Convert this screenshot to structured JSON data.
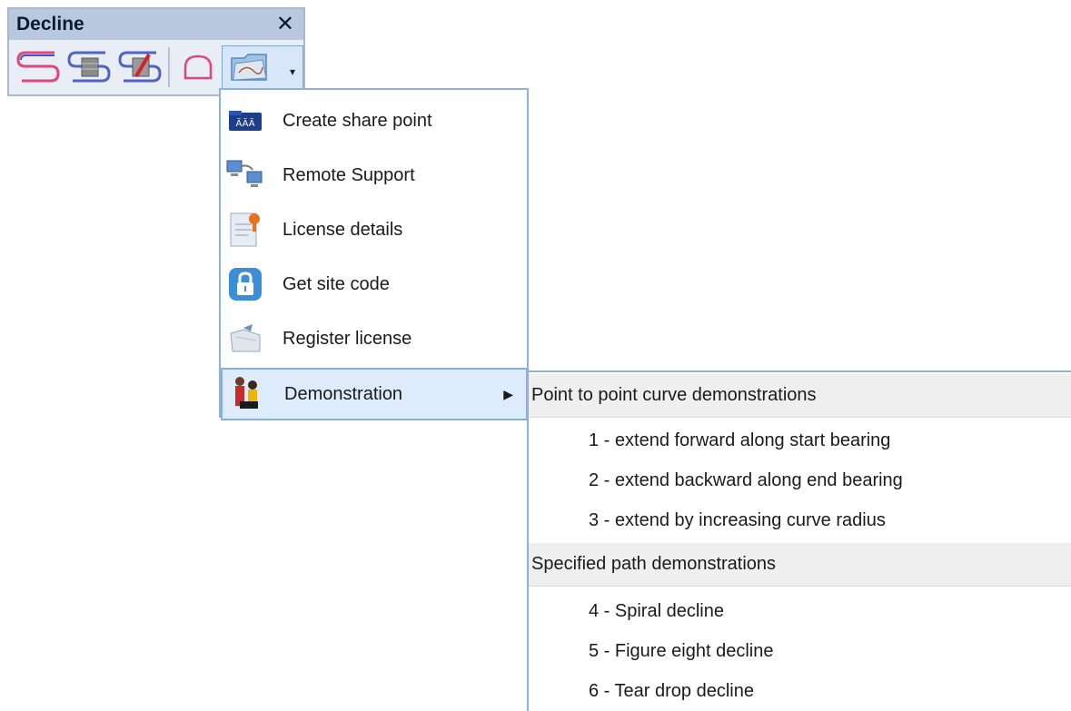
{
  "toolbar": {
    "title": "Decline",
    "close_label": "✕",
    "tools": [
      {
        "icon": "s-curve-pink-blue-icon"
      },
      {
        "icon": "s-curve-gray-icon"
      },
      {
        "icon": "s-curve-red-pencil-icon"
      },
      {
        "icon": "outline-shape-pink-icon"
      }
    ],
    "dropdown_icon": "folder-map-icon",
    "dropdown_caret": "▾"
  },
  "menu": {
    "items": [
      {
        "label": "Create share point",
        "icon": "share-point-folder-icon"
      },
      {
        "label": "Remote Support",
        "icon": "remote-computers-icon"
      },
      {
        "label": "License details",
        "icon": "license-certificate-icon"
      },
      {
        "label": "Get site code",
        "icon": "lock-icon"
      },
      {
        "label": "Register license",
        "icon": "folder-register-icon"
      },
      {
        "label": "Demonstration",
        "icon": "demonstration-figures-icon",
        "submenu_arrow": "▶"
      }
    ]
  },
  "submenu": {
    "sections": [
      {
        "header": "Point to point curve demonstrations",
        "items": [
          "1 - extend forward along start bearing",
          "2 - extend backward along end bearing",
          "3 - extend by increasing curve radius"
        ]
      },
      {
        "header": "Specified path demonstrations",
        "items": [
          "4 - Spiral decline",
          "5 - Figure eight decline",
          "6 - Tear drop decline"
        ]
      }
    ]
  }
}
